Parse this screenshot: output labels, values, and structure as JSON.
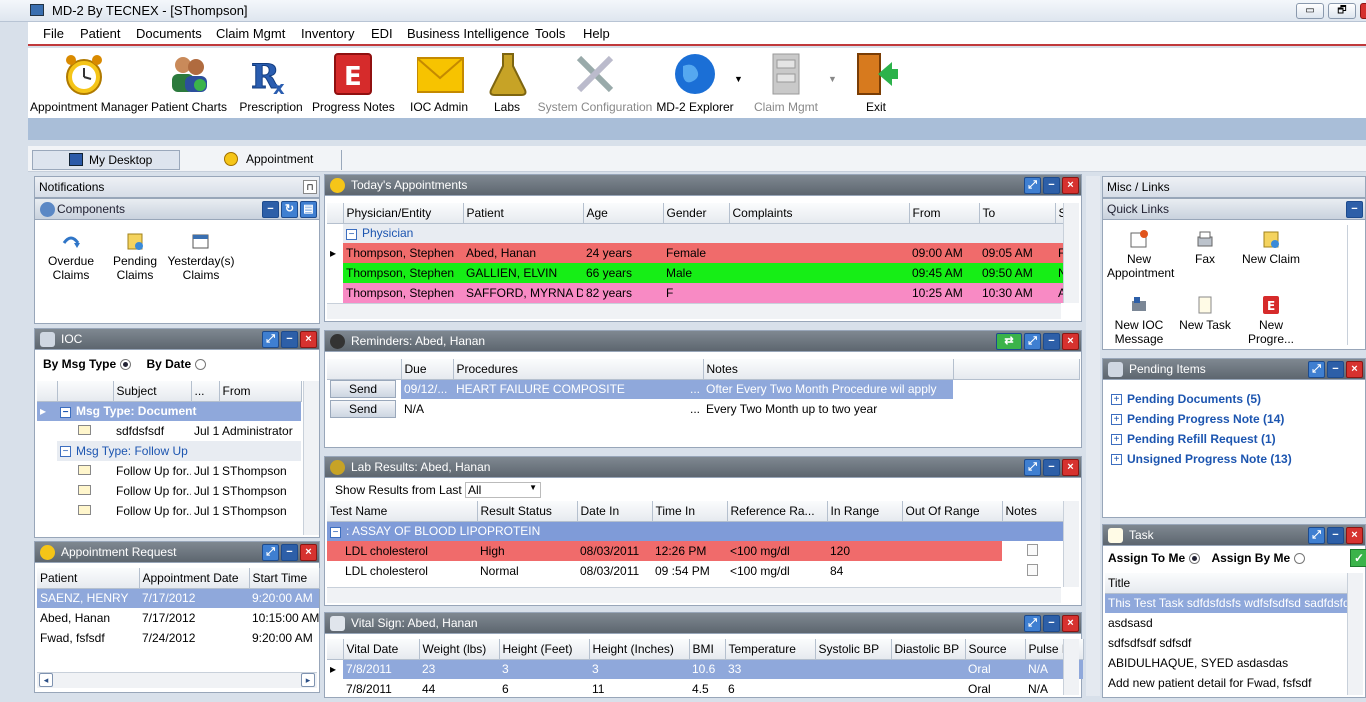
{
  "window": {
    "title": "MD-2 By TECNEX - [SThompson]",
    "min": "▭",
    "restore": "🗗",
    "close": "x"
  },
  "menu": [
    "File",
    "Patient",
    "Documents",
    "Claim Mgmt",
    "Inventory",
    "EDI",
    "Business Intelligence",
    "Tools",
    "Help"
  ],
  "toolbar": [
    {
      "label": "Appointment Manager",
      "icon": "alarm-clock-icon",
      "enabled": true
    },
    {
      "label": "Patient Charts",
      "icon": "users-icon",
      "enabled": true
    },
    {
      "label": "Prescription",
      "icon": "rx-icon",
      "enabled": true
    },
    {
      "label": "Progress Notes",
      "icon": "progress-notes-icon",
      "enabled": true
    },
    {
      "label": "IOC Admin",
      "icon": "envelope-icon",
      "enabled": true
    },
    {
      "label": "Labs",
      "icon": "flask-icon",
      "enabled": true
    },
    {
      "label": "System Configuration",
      "icon": "tools-icon",
      "enabled": false
    },
    {
      "label": "MD-2 Explorer",
      "icon": "globe-icon",
      "enabled": true
    },
    {
      "label": "Claim Mgmt",
      "icon": "cabinet-icon",
      "enabled": false
    },
    {
      "label": "Exit",
      "icon": "exit-door-icon",
      "enabled": true
    }
  ],
  "tabs": [
    "My Desktop",
    "Appointment"
  ],
  "notifications": {
    "title": "Notifications"
  },
  "components": {
    "title": "Components",
    "items": [
      {
        "label": "Overdue Claims"
      },
      {
        "label": "Pending Claims"
      },
      {
        "label": "Yesterday(s) Claims"
      }
    ]
  },
  "ioc": {
    "title": "IOC",
    "by_msg_type": "By Msg Type",
    "by_date": "By Date",
    "columns": [
      "",
      "Subject",
      "...",
      "From"
    ],
    "groups": [
      {
        "label": "Msg Type: Document",
        "rows": [
          {
            "subject": "sdfdsfsdf",
            "date": "Jul 1...",
            "from": "Administrator"
          }
        ]
      },
      {
        "label": "Msg Type: Follow Up",
        "rows": [
          {
            "subject": "Follow Up for...",
            "date": "Jul 1...",
            "from": "SThompson"
          },
          {
            "subject": "Follow Up for...",
            "date": "Jul 1...",
            "from": "SThompson"
          },
          {
            "subject": "Follow Up for...",
            "date": "Jul 1...",
            "from": "SThompson"
          }
        ]
      }
    ]
  },
  "appt_request": {
    "title": "Appointment Request",
    "columns": [
      "Patient",
      "Appointment Date",
      "Start Time"
    ],
    "rows": [
      [
        "SAENZ, HENRY",
        "7/17/2012",
        "9:20:00 AM"
      ],
      [
        "Abed, Hanan",
        "7/17/2012",
        "10:15:00 AM"
      ],
      [
        "Fwad, fsfsdf",
        "7/24/2012",
        "9:20:00 AM"
      ]
    ]
  },
  "todays_appts": {
    "title": "Today's Appointments",
    "columns": [
      "Physician/Entity",
      "Patient",
      "Age",
      "Gender",
      "Complaints",
      "From",
      "To",
      "S"
    ],
    "group": "Physician",
    "rows": [
      {
        "cells": [
          "Thompson, Stephen",
          "Abed, Hanan",
          "24 years",
          "Female",
          "",
          "09:00 AM",
          "09:05 AM",
          "F"
        ],
        "color": "#f06b6b"
      },
      {
        "cells": [
          "Thompson, Stephen",
          "GALLIEN, ELVIN",
          "66 years",
          "Male",
          "",
          "09:45 AM",
          "09:50 AM",
          "N"
        ],
        "color": "#16ee16"
      },
      {
        "cells": [
          "Thompson, Stephen",
          "SAFFORD, MYRNA D",
          "82 years",
          "F",
          "",
          "10:25 AM",
          "10:30 AM",
          "A"
        ],
        "color": "#f88ac4"
      }
    ]
  },
  "reminders": {
    "title": "Reminders: Abed, Hanan",
    "columns": [
      "",
      "Due",
      "Procedures",
      "Notes"
    ],
    "rows": [
      {
        "btn": "Send",
        "due": "09/12/...",
        "proc": "HEART FAILURE COMPOSITE",
        "dots": "...",
        "notes": "Ofter Every Two Month Procedure wil apply"
      },
      {
        "btn": "Send",
        "due": "N/A",
        "proc": "",
        "dots": "...",
        "notes": "Every Two Month up to  two year"
      }
    ]
  },
  "labs": {
    "title": "Lab Results: Abed, Hanan",
    "show_label": "Show Results from Last",
    "show_value": "All",
    "columns": [
      "Test Name",
      "Result Status",
      "Date In",
      "Time In",
      "Reference Ra...",
      "In Range",
      "Out Of Range",
      "Notes"
    ],
    "group": ": ASSAY OF BLOOD LIPOPROTEIN",
    "rows": [
      {
        "cells": [
          "LDL cholesterol",
          "High",
          "08/03/2011",
          "12:26 PM",
          "<100 mg/dl",
          "120",
          ""
        ],
        "color": "#f06b6b"
      },
      {
        "cells": [
          "LDL cholesterol",
          "Normal",
          "08/03/2011",
          "09 :54 PM",
          "<100 mg/dl",
          "84",
          ""
        ],
        "color": "#ffffff"
      }
    ]
  },
  "vitals": {
    "title": "Vital Sign: Abed, Hanan",
    "columns": [
      "Vital Date",
      "Weight (lbs)",
      "Height (Feet)",
      "Height (Inches)",
      "BMI",
      "Temperature",
      "Systolic BP",
      "Diastolic BP",
      "Source",
      "Pulse R"
    ],
    "rows": [
      [
        "7/8/2011",
        "23",
        "3",
        "3",
        "10.6",
        "33",
        "",
        "",
        "Oral",
        "N/A"
      ],
      [
        "7/8/2011",
        "44",
        "6",
        "11",
        "4.5",
        "6",
        "",
        "",
        "Oral",
        "N/A"
      ]
    ]
  },
  "misc": {
    "title": "Misc / Links"
  },
  "quick_links": {
    "title": "Quick Links",
    "items": [
      {
        "label": "New Appointment",
        "icon": "new-appointment-icon"
      },
      {
        "label": "Fax",
        "icon": "fax-icon"
      },
      {
        "label": "New Claim",
        "icon": "new-claim-icon"
      },
      {
        "label": "New IOC Message",
        "icon": "ioc-message-icon"
      },
      {
        "label": "New Task",
        "icon": "task-icon"
      },
      {
        "label": "New Progre...",
        "icon": "progress-notes-icon"
      }
    ]
  },
  "pending": {
    "title": "Pending Items",
    "items": [
      "Pending Documents (5)",
      "Pending Progress Note (14)",
      "Pending Refill Request (1)",
      "Unsigned Progress Note (13)"
    ]
  },
  "task": {
    "title": "Task",
    "assign_to_me": "Assign To Me",
    "assign_by_me": "Assign By Me",
    "column": "Title",
    "rows": [
      "This Test Task  sdfdsfdsfs wdfsfsdfsd sadfdsfdssdf",
      "asdsasd",
      "sdfsdfsdf sdfsdf",
      "ABIDULHAQUE, SYED asdasdas",
      "Add new patient detail for Fwad, fsfsdf"
    ]
  }
}
